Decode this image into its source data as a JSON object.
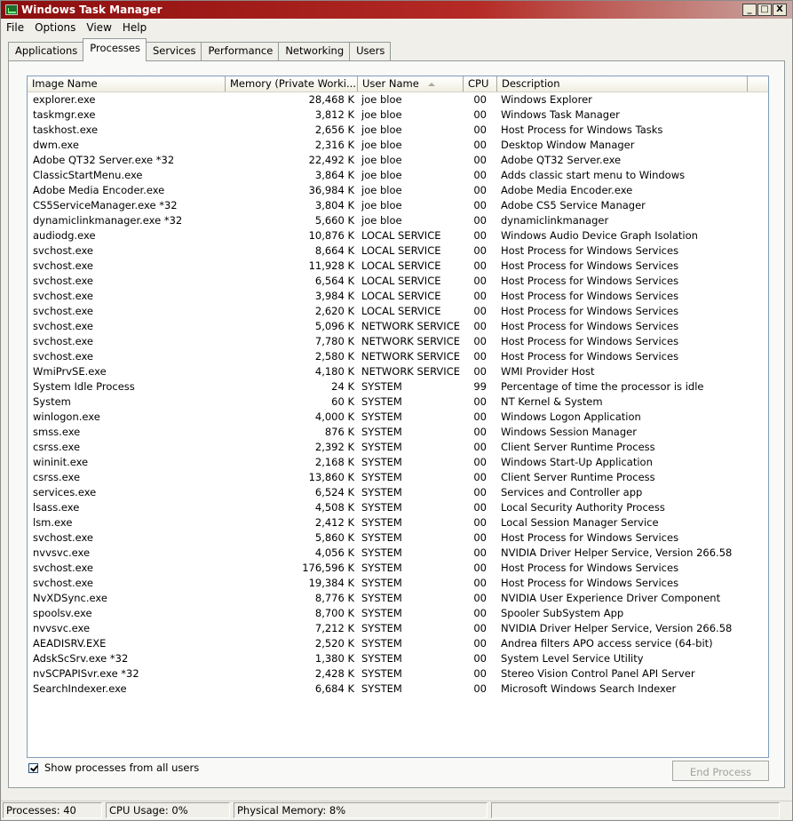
{
  "window": {
    "title": "Windows Task Manager"
  },
  "window_controls": {
    "minimize": "_",
    "maximize": "□",
    "close": "X"
  },
  "menu": [
    "File",
    "Options",
    "View",
    "Help"
  ],
  "tabs": [
    {
      "label": "Applications",
      "active": false
    },
    {
      "label": "Processes",
      "active": true
    },
    {
      "label": "Services",
      "active": false
    },
    {
      "label": "Performance",
      "active": false
    },
    {
      "label": "Networking",
      "active": false
    },
    {
      "label": "Users",
      "active": false
    }
  ],
  "columns": {
    "image_name": "Image Name",
    "memory": "Memory (Private Worki...",
    "user_name": "User Name",
    "cpu": "CPU",
    "description": "Description"
  },
  "processes": [
    [
      "explorer.exe",
      "28,468 K",
      "joe bloe",
      "00",
      "Windows Explorer"
    ],
    [
      "taskmgr.exe",
      "3,812 K",
      "joe bloe",
      "00",
      "Windows Task Manager"
    ],
    [
      "taskhost.exe",
      "2,656 K",
      "joe bloe",
      "00",
      "Host Process for Windows Tasks"
    ],
    [
      "dwm.exe",
      "2,316 K",
      "joe bloe",
      "00",
      "Desktop Window Manager"
    ],
    [
      "Adobe QT32 Server.exe *32",
      "22,492 K",
      "joe bloe",
      "00",
      "Adobe QT32 Server.exe"
    ],
    [
      "ClassicStartMenu.exe",
      "3,864 K",
      "joe bloe",
      "00",
      "Adds classic start menu to Windows"
    ],
    [
      "Adobe Media Encoder.exe",
      "36,984 K",
      "joe bloe",
      "00",
      "Adobe Media Encoder.exe"
    ],
    [
      "CS5ServiceManager.exe *32",
      "3,804 K",
      "joe bloe",
      "00",
      "Adobe CS5 Service Manager"
    ],
    [
      "dynamiclinkmanager.exe *32",
      "5,660 K",
      "joe bloe",
      "00",
      "dynamiclinkmanager"
    ],
    [
      "audiodg.exe",
      "10,876 K",
      "LOCAL SERVICE",
      "00",
      "Windows Audio Device Graph Isolation"
    ],
    [
      "svchost.exe",
      "8,664 K",
      "LOCAL SERVICE",
      "00",
      "Host Process for Windows Services"
    ],
    [
      "svchost.exe",
      "11,928 K",
      "LOCAL SERVICE",
      "00",
      "Host Process for Windows Services"
    ],
    [
      "svchost.exe",
      "6,564 K",
      "LOCAL SERVICE",
      "00",
      "Host Process for Windows Services"
    ],
    [
      "svchost.exe",
      "3,984 K",
      "LOCAL SERVICE",
      "00",
      "Host Process for Windows Services"
    ],
    [
      "svchost.exe",
      "2,620 K",
      "LOCAL SERVICE",
      "00",
      "Host Process for Windows Services"
    ],
    [
      "svchost.exe",
      "5,096 K",
      "NETWORK SERVICE",
      "00",
      "Host Process for Windows Services"
    ],
    [
      "svchost.exe",
      "7,780 K",
      "NETWORK SERVICE",
      "00",
      "Host Process for Windows Services"
    ],
    [
      "svchost.exe",
      "2,580 K",
      "NETWORK SERVICE",
      "00",
      "Host Process for Windows Services"
    ],
    [
      "WmiPrvSE.exe",
      "4,180 K",
      "NETWORK SERVICE",
      "00",
      "WMI Provider Host"
    ],
    [
      "System Idle Process",
      "24 K",
      "SYSTEM",
      "99",
      "Percentage of time the processor is idle"
    ],
    [
      "System",
      "60 K",
      "SYSTEM",
      "00",
      "NT Kernel & System"
    ],
    [
      "winlogon.exe",
      "4,000 K",
      "SYSTEM",
      "00",
      "Windows Logon Application"
    ],
    [
      "smss.exe",
      "876 K",
      "SYSTEM",
      "00",
      "Windows Session Manager"
    ],
    [
      "csrss.exe",
      "2,392 K",
      "SYSTEM",
      "00",
      "Client Server Runtime Process"
    ],
    [
      "wininit.exe",
      "2,168 K",
      "SYSTEM",
      "00",
      "Windows Start-Up Application"
    ],
    [
      "csrss.exe",
      "13,860 K",
      "SYSTEM",
      "00",
      "Client Server Runtime Process"
    ],
    [
      "services.exe",
      "6,524 K",
      "SYSTEM",
      "00",
      "Services and Controller app"
    ],
    [
      "lsass.exe",
      "4,508 K",
      "SYSTEM",
      "00",
      "Local Security Authority Process"
    ],
    [
      "lsm.exe",
      "2,412 K",
      "SYSTEM",
      "00",
      "Local Session Manager Service"
    ],
    [
      "svchost.exe",
      "5,860 K",
      "SYSTEM",
      "00",
      "Host Process for Windows Services"
    ],
    [
      "nvvsvc.exe",
      "4,056 K",
      "SYSTEM",
      "00",
      "NVIDIA Driver Helper Service, Version 266.58"
    ],
    [
      "svchost.exe",
      "176,596 K",
      "SYSTEM",
      "00",
      "Host Process for Windows Services"
    ],
    [
      "svchost.exe",
      "19,384 K",
      "SYSTEM",
      "00",
      "Host Process for Windows Services"
    ],
    [
      "NvXDSync.exe",
      "8,776 K",
      "SYSTEM",
      "00",
      "NVIDIA User Experience Driver Component"
    ],
    [
      "spoolsv.exe",
      "8,700 K",
      "SYSTEM",
      "00",
      "Spooler SubSystem App"
    ],
    [
      "nvvsvc.exe",
      "7,212 K",
      "SYSTEM",
      "00",
      "NVIDIA Driver Helper Service, Version 266.58"
    ],
    [
      "AEADISRV.EXE",
      "2,520 K",
      "SYSTEM",
      "00",
      "Andrea filters APO access service (64-bit)"
    ],
    [
      "AdskScSrv.exe *32",
      "1,380 K",
      "SYSTEM",
      "00",
      "System Level Service Utility"
    ],
    [
      "nvSCPAPISvr.exe *32",
      "2,428 K",
      "SYSTEM",
      "00",
      "Stereo Vision Control Panel API Server"
    ],
    [
      "SearchIndexer.exe",
      "6,684 K",
      "SYSTEM",
      "00",
      "Microsoft Windows Search Indexer"
    ]
  ],
  "show_all_users": {
    "label": "Show processes from all users",
    "checked": true
  },
  "end_process": {
    "label": "End Process",
    "enabled": false
  },
  "status": {
    "processes": "Processes: 40",
    "cpu_usage": "CPU Usage: 0%",
    "physical_memory": "Physical Memory: 8%"
  }
}
